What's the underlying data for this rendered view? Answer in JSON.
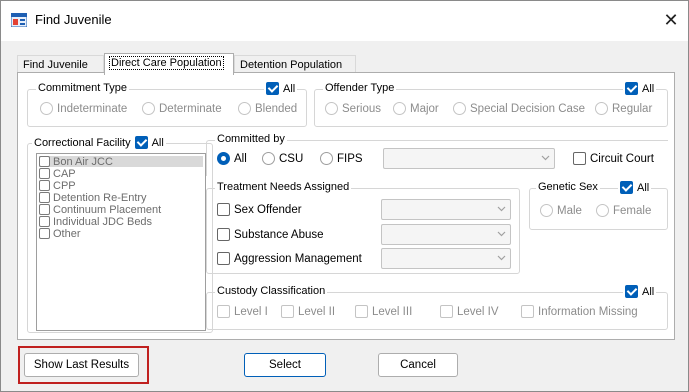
{
  "window": {
    "title": "Find Juvenile",
    "app_icon": "window-app-icon",
    "close_symbol": "✕"
  },
  "tabs": [
    {
      "label": "Find Juvenile",
      "active": false
    },
    {
      "label": "Direct Care Population",
      "active": true
    },
    {
      "label": "Detention Population",
      "active": false
    }
  ],
  "commitment_type": {
    "legend": "Commitment Type",
    "all_label": "All",
    "all_checked": true,
    "options": [
      "Indeterminate",
      "Determinate",
      "Blended"
    ]
  },
  "offender_type": {
    "legend": "Offender Type",
    "all_label": "All",
    "all_checked": true,
    "options": [
      "Serious",
      "Major",
      "Special Decision Case",
      "Regular"
    ]
  },
  "correctional_facility": {
    "legend": "Correctional Facility",
    "all_label": "All",
    "all_checked": true,
    "items": [
      "Bon Air JCC",
      "CAP",
      "CPP",
      "Detention Re-Entry",
      "Continuum Placement",
      "Individual JDC Beds",
      "Other"
    ]
  },
  "committed_by": {
    "legend": "Committed by",
    "options": [
      "All",
      "CSU",
      "FIPS"
    ],
    "selected": "All",
    "circuit_court_label": "Circuit Court"
  },
  "treatment_needs": {
    "legend": "Treatment Needs Assigned",
    "items": [
      "Sex Offender",
      "Substance Abuse",
      "Aggression Management"
    ]
  },
  "genetic_sex": {
    "legend": "Genetic Sex",
    "all_label": "All",
    "all_checked": true,
    "options": [
      "Male",
      "Female"
    ]
  },
  "custody_classification": {
    "legend": "Custody Classification",
    "all_label": "All",
    "all_checked": true,
    "options": [
      "Level I",
      "Level II",
      "Level III",
      "Level IV",
      "Information Missing"
    ]
  },
  "buttons": {
    "show_last_results": "Show Last Results",
    "select": "Select",
    "cancel": "Cancel"
  },
  "colors": {
    "accent": "#005fb8",
    "highlight_box": "#c0201f"
  }
}
